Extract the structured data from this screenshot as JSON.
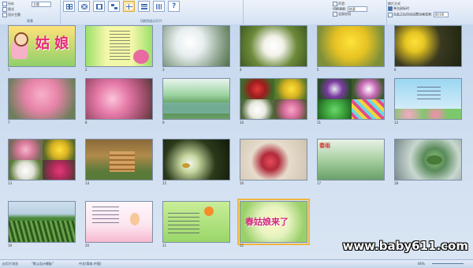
{
  "ribbon": {
    "opt_top": "另存",
    "opt_field": "主题",
    "opt_link": "版式",
    "opt_link2": "设计主题",
    "group_left_label": "背景",
    "group_center_label": "切换到此幻灯片",
    "speed_label": "切换速度:",
    "speed_value": "快速",
    "apply_all": "全部应用",
    "sound_label": "声音:",
    "advance_label": "换片方式",
    "on_click": "单击鼠标时",
    "auto_after": "在此之后自动设置动画效果:",
    "time_value": "00:00"
  },
  "slides": [
    {
      "n": "1",
      "title": "姑 娘",
      "theme": "cartoon"
    },
    {
      "n": "2",
      "theme": "poem"
    },
    {
      "n": "3",
      "theme": "pearblossom"
    },
    {
      "n": "4",
      "theme": "whiteflower"
    },
    {
      "n": "5",
      "theme": "forsythia"
    },
    {
      "n": "6",
      "theme": "yellowflower"
    },
    {
      "n": "7",
      "theme": "peachtree"
    },
    {
      "n": "8",
      "theme": "peachclose"
    },
    {
      "n": "9",
      "theme": "willow"
    },
    {
      "n": "10",
      "theme": "collage1"
    },
    {
      "n": "11",
      "theme": "collage2"
    },
    {
      "n": "12",
      "theme": "poemflower"
    },
    {
      "n": "13",
      "theme": "collage3"
    },
    {
      "n": "14",
      "theme": "beehive"
    },
    {
      "n": "15",
      "theme": "bee"
    },
    {
      "n": "16",
      "theme": "redbud"
    },
    {
      "n": "17",
      "title": "春雨",
      "theme": "rainscene"
    },
    {
      "n": "18",
      "theme": "frog"
    },
    {
      "n": "19",
      "theme": "field"
    },
    {
      "n": "20",
      "theme": "poem2"
    },
    {
      "n": "21",
      "theme": "poem3"
    },
    {
      "n": "22",
      "title": "春姑娘来了",
      "theme": "final"
    }
  ],
  "status": {
    "view": "幻灯片浏览",
    "theme": "\"默认设计模板\"",
    "lang": "中文(简体,中国)",
    "zoom": "66%"
  },
  "watermark": "www.baby611.com"
}
